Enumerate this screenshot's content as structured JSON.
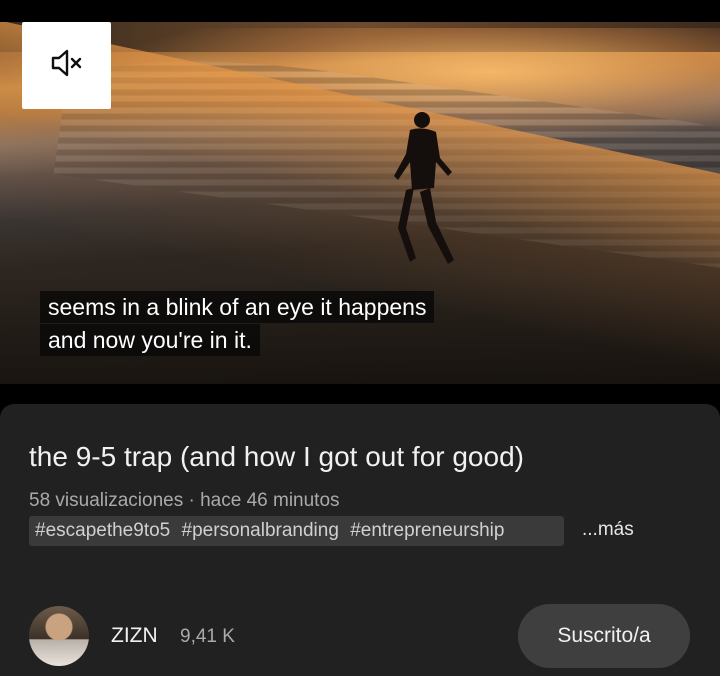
{
  "player": {
    "mute_icon": "volume-muted-icon",
    "captions": [
      "seems in a blink of an eye it happens",
      "and now you're in it."
    ]
  },
  "video": {
    "title": "the 9-5 trap (and how I got out for good)",
    "views": "58 visualizaciones",
    "separator": "·",
    "age": "hace 46 minutos",
    "hashtags": [
      "#escapethe9to5",
      "#personalbranding",
      "#entrepreneurship"
    ],
    "more_label": "...más"
  },
  "channel": {
    "name": "ZIZN",
    "subscribers": "9,41 K",
    "subscribe_label": "Suscrito/a"
  }
}
